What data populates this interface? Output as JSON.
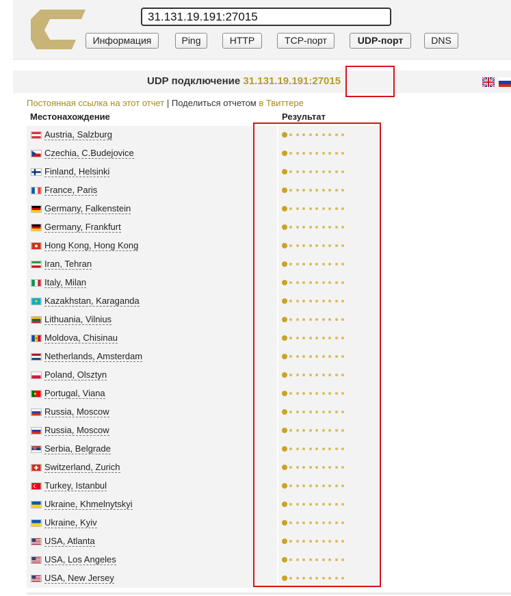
{
  "host_input": {
    "value": "31.131.19.191:27015"
  },
  "tabs": [
    {
      "label": "Информация"
    },
    {
      "label": "Ping"
    },
    {
      "label": "HTTP"
    },
    {
      "label": "TCP-порт"
    },
    {
      "label": "UDP-порт",
      "active": true
    },
    {
      "label": "DNS"
    }
  ],
  "panel": {
    "title_prefix": "UDP подключение",
    "target": "31.131.19.191:27015"
  },
  "links": {
    "permalink": "Постоянная ссылка на этот отчет",
    "separator": "|",
    "share_prefix": "Поделиться отчетом",
    "share_link": "в Твиттере"
  },
  "table": {
    "header_location": "Местонахождение",
    "header_result": "Результат",
    "rows": [
      {
        "location": "Austria, Salzburg",
        "flag": "at"
      },
      {
        "location": "Czechia, C.Budejovice",
        "flag": "cz"
      },
      {
        "location": "Finland, Helsinki",
        "flag": "fi"
      },
      {
        "location": "France, Paris",
        "flag": "fr"
      },
      {
        "location": "Germany, Falkenstein",
        "flag": "de"
      },
      {
        "location": "Germany, Frankfurt",
        "flag": "de"
      },
      {
        "location": "Hong Kong, Hong Kong",
        "flag": "hk"
      },
      {
        "location": "Iran, Tehran",
        "flag": "ir"
      },
      {
        "location": "Italy, Milan",
        "flag": "it"
      },
      {
        "location": "Kazakhstan, Karaganda",
        "flag": "kz"
      },
      {
        "location": "Lithuania, Vilnius",
        "flag": "lt"
      },
      {
        "location": "Moldova, Chisinau",
        "flag": "md"
      },
      {
        "location": "Netherlands, Amsterdam",
        "flag": "nl"
      },
      {
        "location": "Poland, Olsztyn",
        "flag": "pl"
      },
      {
        "location": "Portugal, Viana",
        "flag": "pt"
      },
      {
        "location": "Russia, Moscow",
        "flag": "ru"
      },
      {
        "location": "Russia, Moscow",
        "flag": "ru"
      },
      {
        "location": "Serbia, Belgrade",
        "flag": "rs"
      },
      {
        "location": "Switzerland, Zurich",
        "flag": "ch"
      },
      {
        "location": "Turkey, Istanbul",
        "flag": "tr"
      },
      {
        "location": "Ukraine, Khmelnytskyi",
        "flag": "ua"
      },
      {
        "location": "Ukraine, Kyiv",
        "flag": "ua"
      },
      {
        "location": "USA, Atlanta",
        "flag": "us"
      },
      {
        "location": "USA, Los Angeles",
        "flag": "us"
      },
      {
        "location": "USA, New Jersey",
        "flag": "us"
      }
    ]
  },
  "colors": {
    "accent": "#b59a2c",
    "dot": "#c9a227",
    "highlight_box": "#d8141c"
  },
  "language_flags": [
    "uk-flag-icon",
    "ru-flag-icon"
  ]
}
